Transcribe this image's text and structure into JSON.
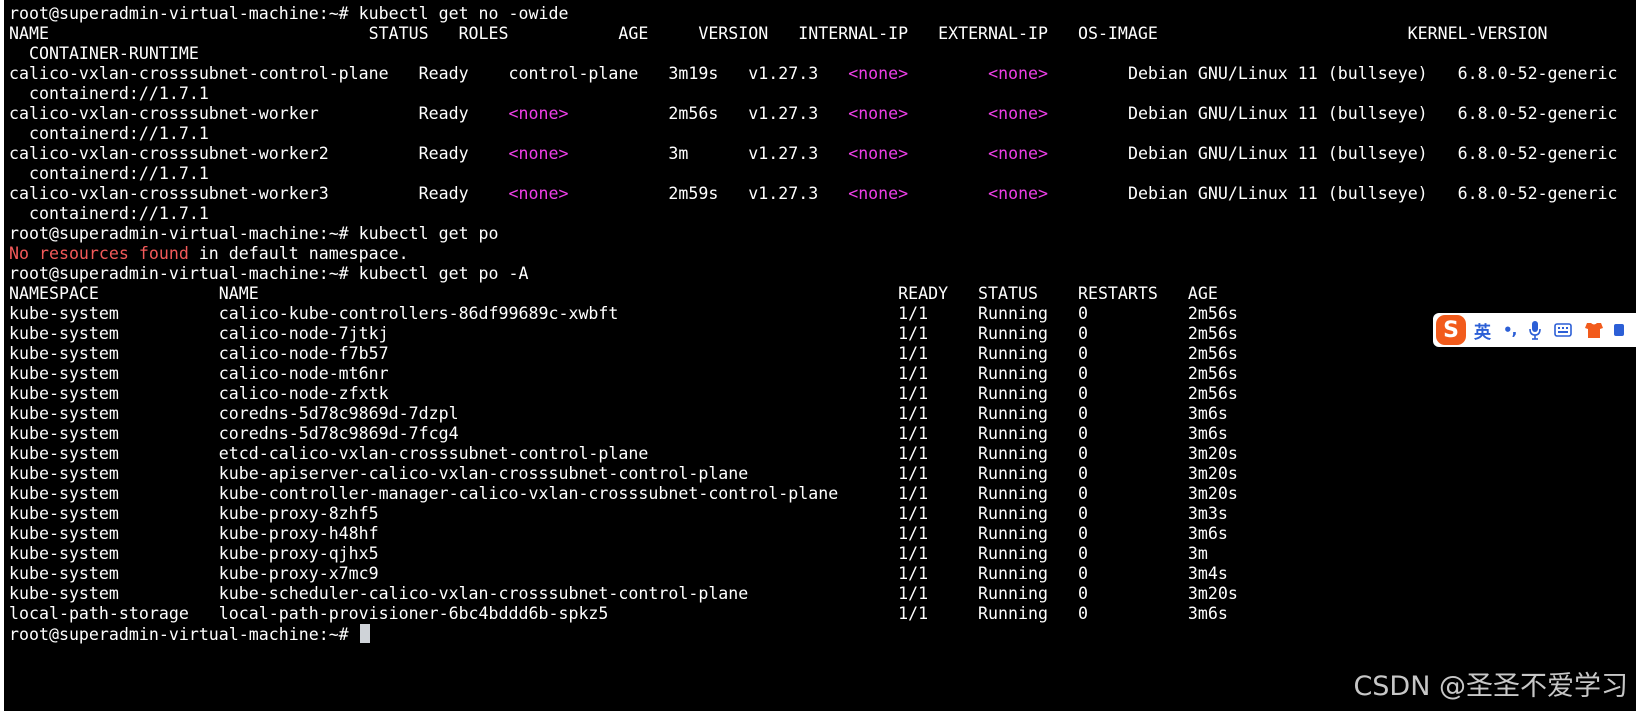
{
  "terminal": {
    "colors": {
      "background": "#000000",
      "text": "#ffffff",
      "none_value": "#ee3fe6",
      "error": "#f25a5a",
      "cursor": "#cfd3d8"
    },
    "lines": [
      [
        {
          "t": "root@superadmin-virtual-machine:~# kubectl get no -owide"
        }
      ],
      [
        {
          "t": "NAME                                STATUS   ROLES           AGE     VERSION   INTERNAL-IP   EXTERNAL-IP   OS-IMAGE                         KERNEL-VERSION"
        }
      ],
      [
        {
          "t": "  CONTAINER-RUNTIME"
        }
      ],
      [
        {
          "t": "calico-vxlan-crosssubnet-control-plane   Ready    control-plane   3m19s   v1.27.3   "
        },
        {
          "t": "<none>",
          "c": "none"
        },
        {
          "t": "        "
        },
        {
          "t": "<none>",
          "c": "none"
        },
        {
          "t": "        Debian GNU/Linux 11 (bullseye)   6.8.0-52-generic"
        }
      ],
      [
        {
          "t": "  containerd://1.7.1"
        }
      ],
      [
        {
          "t": "calico-vxlan-crosssubnet-worker          Ready    "
        },
        {
          "t": "<none>",
          "c": "none"
        },
        {
          "t": "          2m56s   v1.27.3   "
        },
        {
          "t": "<none>",
          "c": "none"
        },
        {
          "t": "        "
        },
        {
          "t": "<none>",
          "c": "none"
        },
        {
          "t": "        Debian GNU/Linux 11 (bullseye)   6.8.0-52-generic"
        }
      ],
      [
        {
          "t": "  containerd://1.7.1"
        }
      ],
      [
        {
          "t": "calico-vxlan-crosssubnet-worker2         Ready    "
        },
        {
          "t": "<none>",
          "c": "none"
        },
        {
          "t": "          3m      v1.27.3   "
        },
        {
          "t": "<none>",
          "c": "none"
        },
        {
          "t": "        "
        },
        {
          "t": "<none>",
          "c": "none"
        },
        {
          "t": "        Debian GNU/Linux 11 (bullseye)   6.8.0-52-generic"
        }
      ],
      [
        {
          "t": "  containerd://1.7.1"
        }
      ],
      [
        {
          "t": "calico-vxlan-crosssubnet-worker3         Ready    "
        },
        {
          "t": "<none>",
          "c": "none"
        },
        {
          "t": "          2m59s   v1.27.3   "
        },
        {
          "t": "<none>",
          "c": "none"
        },
        {
          "t": "        "
        },
        {
          "t": "<none>",
          "c": "none"
        },
        {
          "t": "        Debian GNU/Linux 11 (bullseye)   6.8.0-52-generic"
        }
      ],
      [
        {
          "t": "  containerd://1.7.1"
        }
      ],
      [
        {
          "t": "root@superadmin-virtual-machine:~# kubectl get po"
        }
      ],
      [
        {
          "t": "No resources found",
          "c": "error"
        },
        {
          "t": " in default namespace."
        }
      ],
      [
        {
          "t": "root@superadmin-virtual-machine:~# kubectl get po -A"
        }
      ],
      [
        {
          "t": "NAMESPACE            NAME                                                                READY   STATUS    RESTARTS   AGE"
        }
      ],
      [
        {
          "t": "kube-system          calico-kube-controllers-86df99689c-xwbft                            1/1     Running   0          2m56s"
        }
      ],
      [
        {
          "t": "kube-system          calico-node-7jtkj                                                   1/1     Running   0          2m56s"
        }
      ],
      [
        {
          "t": "kube-system          calico-node-f7b57                                                   1/1     Running   0          2m56s"
        }
      ],
      [
        {
          "t": "kube-system          calico-node-mt6nr                                                   1/1     Running   0          2m56s"
        }
      ],
      [
        {
          "t": "kube-system          calico-node-zfxtk                                                   1/1     Running   0          2m56s"
        }
      ],
      [
        {
          "t": "kube-system          coredns-5d78c9869d-7dzpl                                            1/1     Running   0          3m6s"
        }
      ],
      [
        {
          "t": "kube-system          coredns-5d78c9869d-7fcg4                                            1/1     Running   0          3m6s"
        }
      ],
      [
        {
          "t": "kube-system          etcd-calico-vxlan-crosssubnet-control-plane                         1/1     Running   0          3m20s"
        }
      ],
      [
        {
          "t": "kube-system          kube-apiserver-calico-vxlan-crosssubnet-control-plane               1/1     Running   0          3m20s"
        }
      ],
      [
        {
          "t": "kube-system          kube-controller-manager-calico-vxlan-crosssubnet-control-plane      1/1     Running   0          3m20s"
        }
      ],
      [
        {
          "t": "kube-system          kube-proxy-8zhf5                                                    1/1     Running   0          3m3s"
        }
      ],
      [
        {
          "t": "kube-system          kube-proxy-h48hf                                                    1/1     Running   0          3m6s"
        }
      ],
      [
        {
          "t": "kube-system          kube-proxy-qjhx5                                                    1/1     Running   0          3m"
        }
      ],
      [
        {
          "t": "kube-system          kube-proxy-x7mc9                                                    1/1     Running   0          3m4s"
        }
      ],
      [
        {
          "t": "kube-system          kube-scheduler-calico-vxlan-crosssubnet-control-plane               1/1     Running   0          3m20s"
        }
      ],
      [
        {
          "t": "local-path-storage   local-path-provisioner-6bc4bddd6b-spkz5                             1/1     Running   0          3m6s"
        }
      ],
      [
        {
          "t": "root@superadmin-virtual-machine:~# "
        },
        {
          "c": "cursor"
        }
      ]
    ]
  },
  "ime_toolbar": {
    "logo_letter": "S",
    "mode_label": "英",
    "punct_symbol": "•,",
    "icons": [
      "sogou-logo-icon",
      "mode-toggle",
      "punctuation-icon",
      "microphone-icon",
      "keyboard-icon",
      "skin-icon"
    ],
    "accent_color": "#f25b1c",
    "mode_color": "#2c5fd6"
  },
  "watermark": {
    "text": "CSDN @圣圣不爱学习"
  }
}
